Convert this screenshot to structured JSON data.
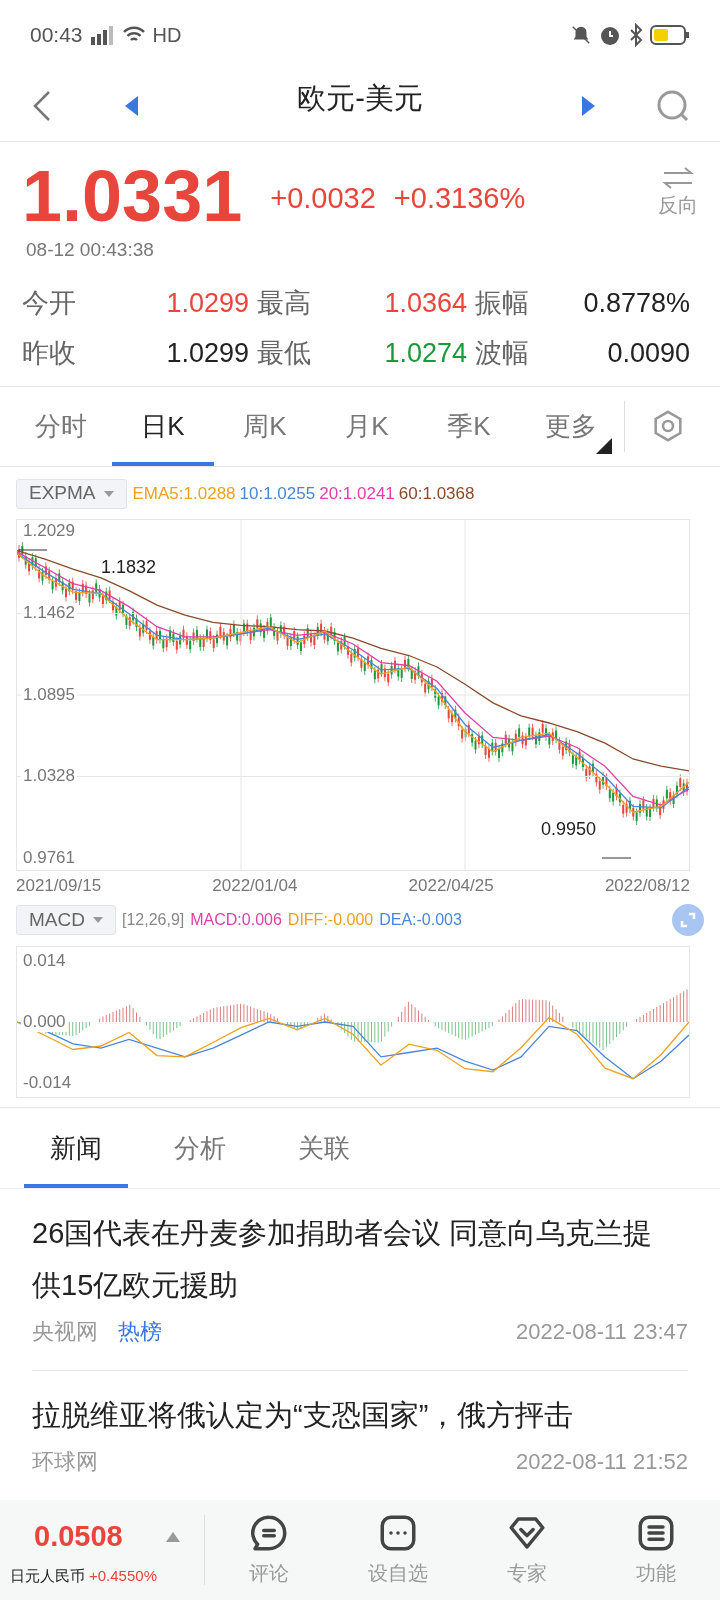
{
  "status_bar": {
    "time": "00:43",
    "network": "HD"
  },
  "header": {
    "title": "欧元-美元"
  },
  "quote": {
    "price": "1.0331",
    "change": "+0.0032",
    "change_pct": "+0.3136%",
    "timestamp": "08-12 00:43:38",
    "reverse_label": "反向"
  },
  "stats": [
    {
      "label": "今开",
      "value": "1.0299",
      "color": "#e8453c"
    },
    {
      "label": "最高",
      "value": "1.0364",
      "color": "#e8453c"
    },
    {
      "label": "振幅",
      "value": "0.8778%",
      "color": "#222222"
    },
    {
      "label": "昨收",
      "value": "1.0299",
      "color": "#222222"
    },
    {
      "label": "最低",
      "value": "1.0274",
      "color": "#1a9a3c"
    },
    {
      "label": "波幅",
      "value": "0.0090",
      "color": "#222222"
    }
  ],
  "period_tabs": [
    {
      "label": "分时",
      "selected": false
    },
    {
      "label": "日K",
      "selected": true
    },
    {
      "label": "周K",
      "selected": false
    },
    {
      "label": "月K",
      "selected": false
    },
    {
      "label": "季K",
      "selected": false
    },
    {
      "label": "更多",
      "selected": false
    }
  ],
  "main_chart": {
    "indicator": "EXPMA",
    "legend": [
      {
        "text": "EMA5:1.0288",
        "color": "#f0a020"
      },
      {
        "text": "10:1.0255",
        "color": "#4a86d8"
      },
      {
        "text": "20:1.0241",
        "color": "#e040a8"
      },
      {
        "text": "60:1.0368",
        "color": "#8b4a2b"
      }
    ],
    "high_label": "1.1832",
    "low_label": "0.9950",
    "x_labels": [
      "2021/09/15",
      "2022/01/04",
      "2022/04/25",
      "2022/08/12"
    ],
    "chart_data": {
      "type": "line",
      "grid": true,
      "ylim": [
        0.9678,
        1.2112
      ],
      "yticks": [
        {
          "value": 1.2029,
          "label": "1.2029"
        },
        {
          "value": 1.1462,
          "label": "1.1462"
        },
        {
          "value": 1.0895,
          "label": "1.0895"
        },
        {
          "value": 1.0328,
          "label": "1.0328"
        },
        {
          "value": 0.9761,
          "label": "0.9761"
        }
      ],
      "series": [
        {
          "color": "#8b4a2b",
          "values": [
            1.19,
            1.184,
            1.177,
            1.171,
            1.162,
            1.152,
            1.145,
            1.14,
            1.138,
            1.137,
            1.135,
            1.134,
            1.129,
            1.122,
            1.117,
            1.109,
            1.097,
            1.084,
            1.075,
            1.07,
            1.064,
            1.056,
            1.045,
            1.04,
            1.0368
          ]
        },
        {
          "color": "#e040a8",
          "values": [
            1.189,
            1.178,
            1.167,
            1.162,
            1.151,
            1.137,
            1.13,
            1.13,
            1.132,
            1.135,
            1.131,
            1.133,
            1.125,
            1.112,
            1.11,
            1.099,
            1.077,
            1.06,
            1.058,
            1.061,
            1.053,
            1.04,
            1.019,
            1.013,
            1.0241
          ]
        },
        {
          "color": "#4a86d8",
          "values": [
            1.188,
            1.175,
            1.163,
            1.16,
            1.146,
            1.131,
            1.128,
            1.129,
            1.132,
            1.136,
            1.128,
            1.132,
            1.121,
            1.107,
            1.108,
            1.094,
            1.069,
            1.053,
            1.058,
            1.062,
            1.049,
            1.033,
            1.012,
            1.011,
            1.0255
          ]
        },
        {
          "color": "#f0a020",
          "values": [
            1.188,
            1.172,
            1.161,
            1.16,
            1.142,
            1.128,
            1.128,
            1.129,
            1.133,
            1.137,
            1.126,
            1.134,
            1.118,
            1.104,
            1.109,
            1.091,
            1.064,
            1.05,
            1.06,
            1.063,
            1.046,
            1.028,
            1.008,
            1.012,
            1.0288
          ]
        }
      ]
    }
  },
  "macd_chart": {
    "indicator": "MACD",
    "params": "[12,26,9]",
    "legend": [
      {
        "text": "MACD:0.006",
        "color": "#e040a8"
      },
      {
        "text": "DIFF:-0.000",
        "color": "#f0a020"
      },
      {
        "text": "DEA:-0.003",
        "color": "#4a86d8"
      }
    ],
    "chart_data": {
      "type": "line",
      "ylim": [
        -0.0172,
        0.0172
      ],
      "yticks": [
        {
          "value": 0.014,
          "label": "0.014"
        },
        {
          "value": 0,
          "label": "0.000"
        },
        {
          "value": -0.014,
          "label": "-0.014"
        }
      ],
      "series": [
        {
          "color": "#4a86d8",
          "values": [
            0,
            -0.002,
            -0.005,
            -0.006,
            -0.004,
            -0.006,
            -0.008,
            -0.006,
            -0.003,
            0,
            -0.001,
            0,
            -0.001,
            -0.008,
            -0.007,
            -0.006,
            -0.009,
            -0.011,
            -0.008,
            -0.001,
            -0.002,
            -0.008,
            -0.013,
            -0.009,
            -0.003
          ]
        },
        {
          "color": "#f0a020",
          "values": [
            0,
            -0.0031,
            -0.0063,
            -0.0055,
            -0.0024,
            -0.0077,
            -0.008,
            -0.0047,
            -0.0013,
            0.0008,
            -0.0018,
            0.0008,
            -0.0028,
            -0.0099,
            -0.0051,
            -0.0065,
            -0.0107,
            -0.0114,
            -0.0059,
            0.001,
            -0.0028,
            -0.0106,
            -0.013,
            -0.0075,
            0
          ]
        }
      ]
    }
  },
  "news_tabs": [
    {
      "label": "新闻",
      "selected": true
    },
    {
      "label": "分析",
      "selected": false
    },
    {
      "label": "关联",
      "selected": false
    }
  ],
  "news": [
    {
      "title": "26国代表在丹麦参加捐助者会议 同意向乌克兰提供15亿欧元援助",
      "source": "央视网",
      "tag": "热榜",
      "time": "2022-08-11 23:47"
    },
    {
      "title": "拉脱维亚将俄认定为“支恐国家”，俄方抨击",
      "source": "环球网",
      "time": "2022-08-11 21:52"
    }
  ],
  "bottom_bar": {
    "price": "0.0508",
    "name": "日元人民币",
    "change": "+0.4550%",
    "actions": [
      {
        "kind": "comment",
        "label": "评论"
      },
      {
        "kind": "watch",
        "label": "设自选"
      },
      {
        "kind": "expert",
        "label": "专家"
      },
      {
        "kind": "menu",
        "label": "功能"
      }
    ]
  }
}
